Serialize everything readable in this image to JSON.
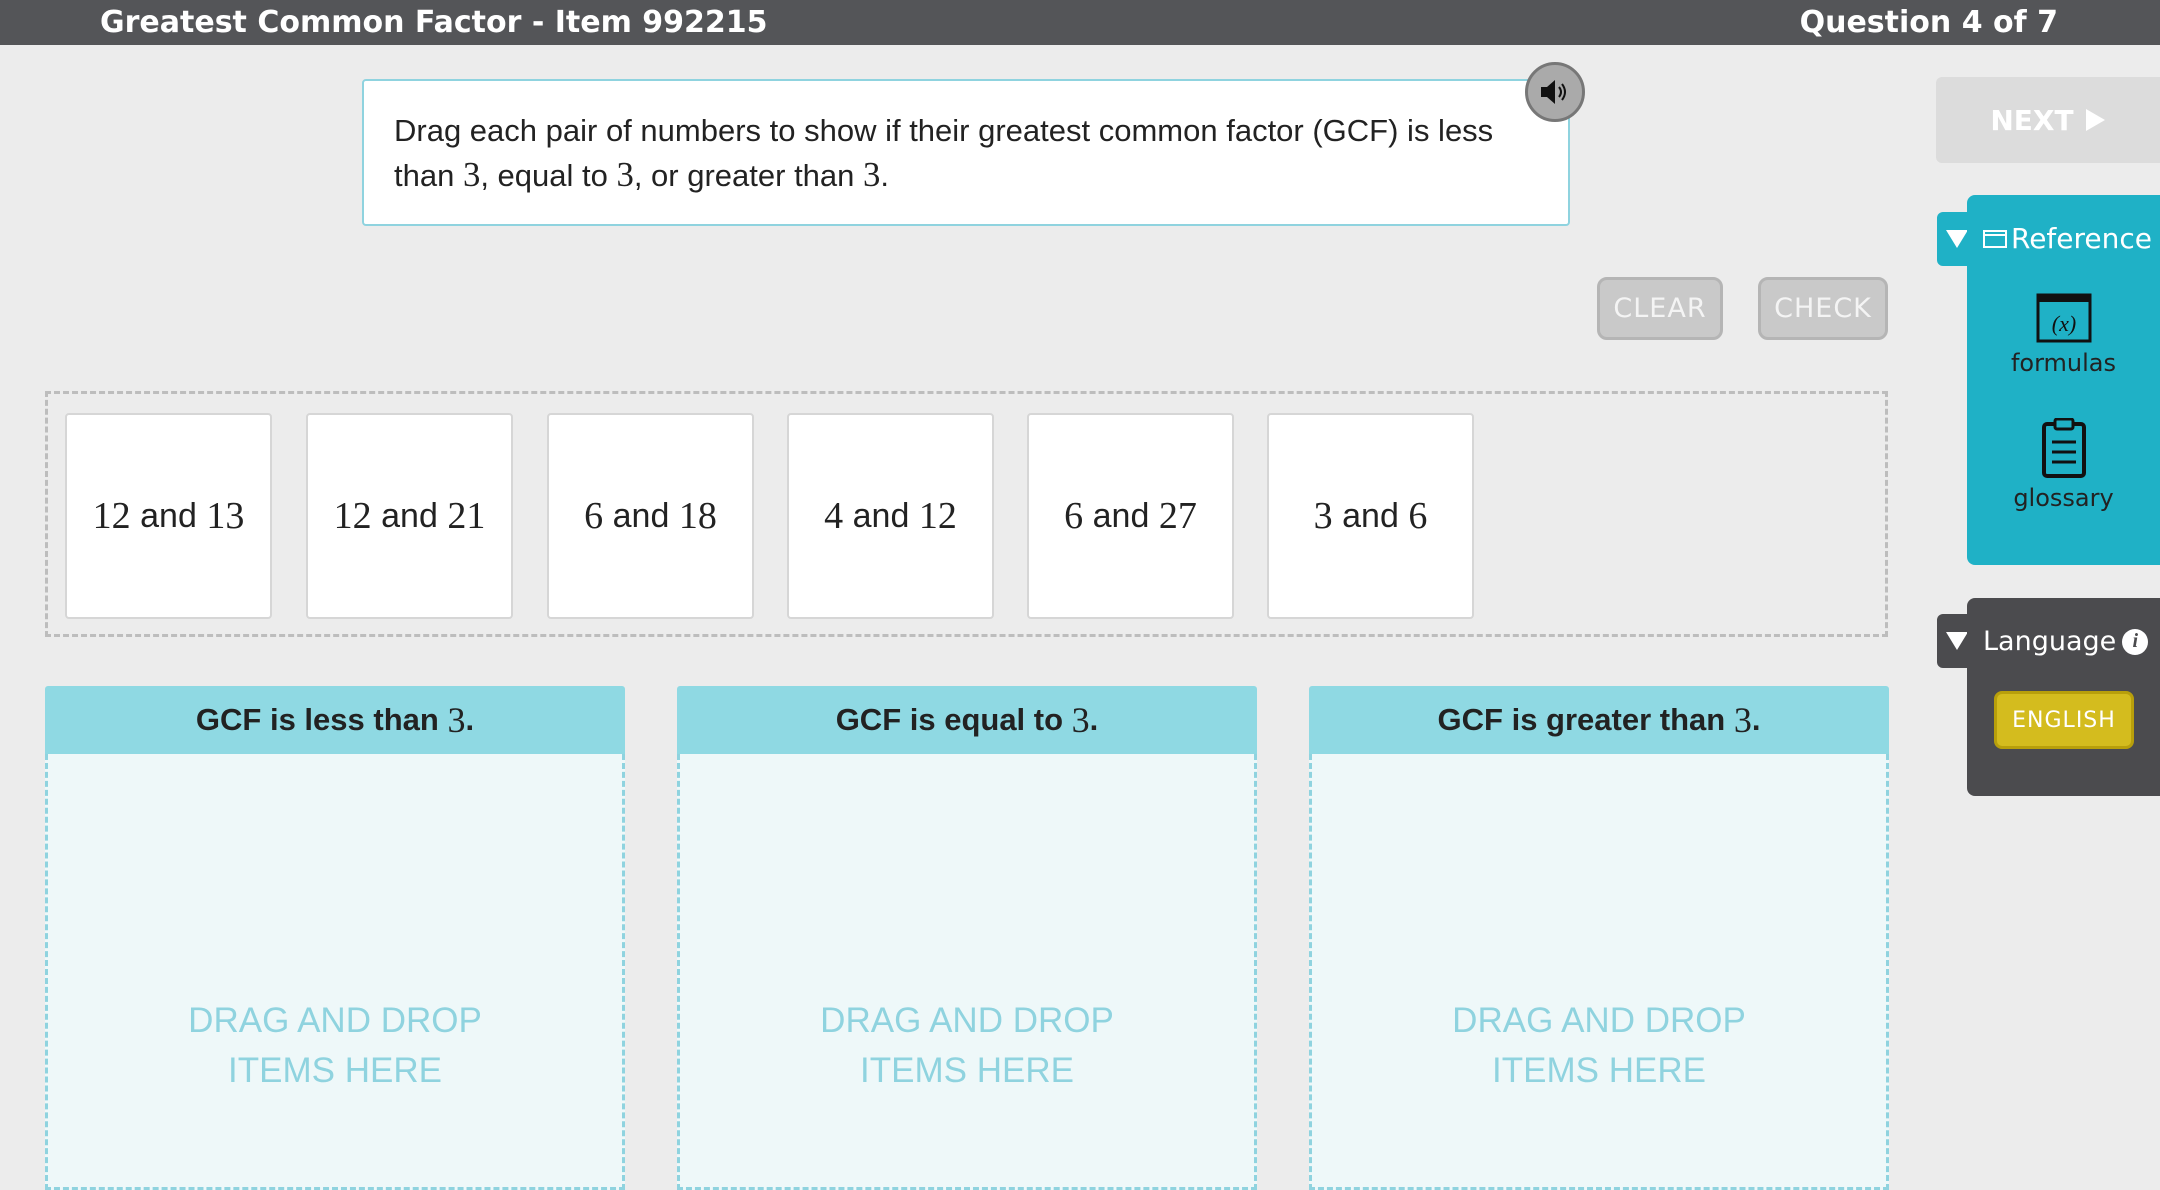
{
  "header": {
    "title": "Greatest Common Factor - Item 992215",
    "question_count": "Question 4 of 7"
  },
  "prompt": {
    "line1": "Drag each pair of numbers to show if their greatest common factor (GCF) is less",
    "line2_a": "than ",
    "line2_n1": "3",
    "line2_b": ", equal to ",
    "line2_n2": "3",
    "line2_c": ", or greater than ",
    "line2_n3": "3",
    "line2_d": "."
  },
  "toolbar": {
    "clear_label": "CLEAR",
    "check_label": "CHECK",
    "next_label": "NEXT"
  },
  "tiles": [
    {
      "a": "12",
      "and": "and",
      "b": "13"
    },
    {
      "a": "12",
      "and": "and",
      "b": "21"
    },
    {
      "a": "6",
      "and": "and",
      "b": "18"
    },
    {
      "a": "4",
      "and": "and",
      "b": "12"
    },
    {
      "a": "6",
      "and": "and",
      "b": "27"
    },
    {
      "a": "3",
      "and": "and",
      "b": "6"
    }
  ],
  "bins": [
    {
      "label": "GCF is less than ",
      "num": "3",
      "suffix": ".",
      "hint": "DRAG AND DROP ITEMS HERE"
    },
    {
      "label": "GCF is equal to ",
      "num": "3",
      "suffix": ".",
      "hint": "DRAG AND DROP ITEMS HERE"
    },
    {
      "label": "GCF is greater than ",
      "num": "3",
      "suffix": ".",
      "hint": "DRAG AND DROP ITEMS HERE"
    }
  ],
  "reference": {
    "title": "Reference",
    "items": [
      {
        "label": "formulas",
        "icon": "formulas-icon"
      },
      {
        "label": "glossary",
        "icon": "glossary-icon"
      }
    ]
  },
  "language": {
    "title": "Language",
    "selected": "ENGLISH"
  },
  "colors": {
    "topbar": "#545558",
    "accent": "#1fb1c6",
    "bin_header": "#8fd9e3",
    "english_button": "#d4bc1e"
  }
}
